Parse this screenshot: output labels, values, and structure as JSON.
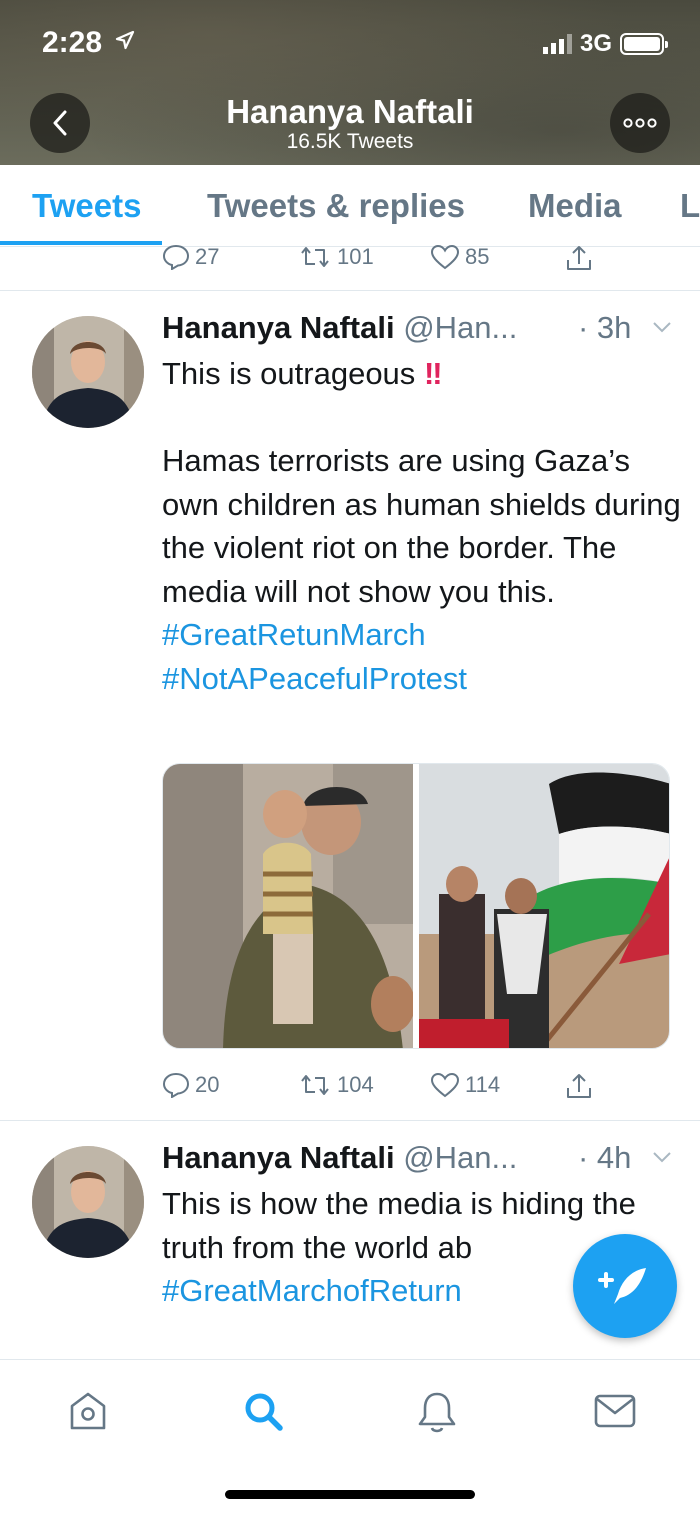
{
  "status_bar": {
    "time": "2:28",
    "network": "3G"
  },
  "header": {
    "title": "Hananya Naftali",
    "subtitle": "16.5K Tweets"
  },
  "tabs": [
    {
      "label": "Tweets"
    },
    {
      "label": "Tweets & replies"
    },
    {
      "label": "Media"
    },
    {
      "label": "L"
    }
  ],
  "prev_tweet_actions": {
    "replies": "27",
    "retweets": "101",
    "likes": "85"
  },
  "tweets": [
    {
      "name": "Hananya Naftali",
      "handle": "@Han...",
      "time": "· 3h",
      "line1": "This is outrageous",
      "emoji": "!!",
      "body": "Hamas terrorists are using Gaza’s own children as human shields during the violent riot on the border. The media will not show you this.",
      "hashtags": [
        "#GreatRetunMarch",
        "#NotAPeacefulProtest"
      ],
      "replies": "20",
      "retweets": "104",
      "likes": "114"
    },
    {
      "name": "Hananya Naftali",
      "handle": "@Han...",
      "time": "· 4h",
      "body": "This is how the media is hiding the truth from the world ab",
      "hashtags": [
        "#GreatMarchofReturn"
      ]
    }
  ],
  "colors": {
    "accent": "#1da1f2",
    "hashtag": "#1b95e0",
    "muted": "#657786",
    "alert": "#e0245e"
  }
}
